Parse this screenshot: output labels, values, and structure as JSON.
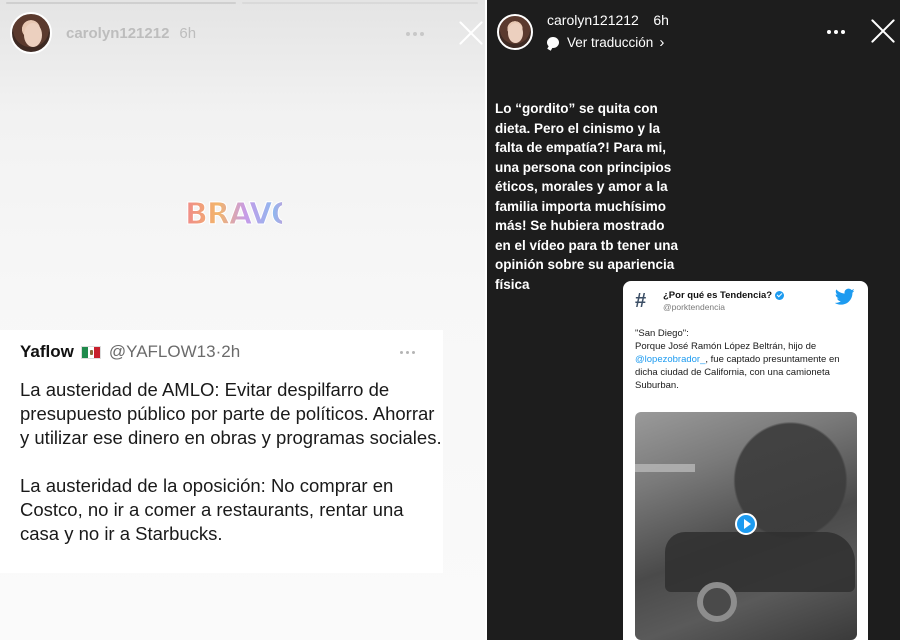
{
  "left_story": {
    "username": "carolyn121212",
    "time": "6h",
    "sticker_text": "BRAVO",
    "tweet": {
      "name": "Yaflow",
      "handle": "@YAFLOW13",
      "separator": "·",
      "time": "2h",
      "paragraph1": "La austeridad de AMLO: Evitar despilfarro de presupuesto público por parte de políticos. Ahorrar y utilizar ese dinero en obras y programas sociales.",
      "paragraph2": "La austeridad de la oposición: No comprar en Costco, no ir a comer a restaurants, rentar una casa y no ir a Starbucks."
    }
  },
  "right_story": {
    "username": "carolyn121212",
    "time": "6h",
    "translate_label": "Ver traducción",
    "story_text": "Lo “gordito” se quita con dieta. Pero el cinismo y la falta de empatía?! Para mi, una persona con principios éticos, morales y amor a la familia importa muchísimo más! Se hubiera mostrado en el vídeo para tb tener una opinión sobre su apariencia física",
    "embed": {
      "title": "¿Por qué es Tendencia?",
      "handle": "@porktendencia",
      "line1": "\"San Diego\":",
      "line2_before": "Porque José Ramón López Beltrán, hijo de",
      "mention": "@lopezobrador_",
      "line2_after": ", fue captado presuntamente en dicha ciudad de California, con una camioneta Suburban."
    }
  },
  "colors": {
    "accent_blue": "#1d9bf0",
    "dark_story_bg": "#1d1d1d"
  },
  "icons": [
    "more-icon",
    "close-icon",
    "translate-bubble-icon",
    "chevron-right-icon",
    "hashtag-icon",
    "verified-icon",
    "twitter-bird-icon",
    "play-icon",
    "mexico-flag-icon"
  ]
}
